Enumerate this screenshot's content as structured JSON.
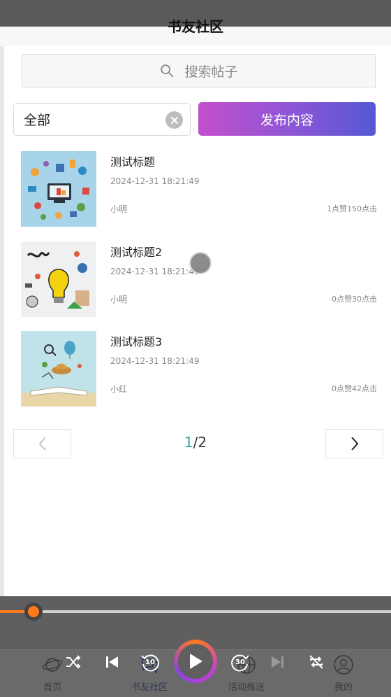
{
  "header": {
    "title": "书友社区"
  },
  "search": {
    "placeholder": "搜索帖子"
  },
  "filter": {
    "value": "全部"
  },
  "publish": {
    "label": "发布内容"
  },
  "posts": [
    {
      "title": "测试标题",
      "date": "2024-12-31 18:21:49",
      "author": "小明",
      "stats": "1点赞150点击"
    },
    {
      "title": "测试标题2",
      "date": "2024-12-31 18:21:49",
      "author": "小明",
      "stats": "0点赞30点击"
    },
    {
      "title": "测试标题3",
      "date": "2024-12-31 18:21:49",
      "author": "小红",
      "stats": "0点赞42点击"
    }
  ],
  "pagination": {
    "current": "1",
    "total": "/2"
  },
  "player": {
    "progress_fraction": 0.085,
    "rewind_seconds": "10",
    "forward_seconds": "30"
  },
  "tabbar": {
    "items": [
      {
        "label": "首页",
        "icon": "planet-icon"
      },
      {
        "label": "书友社区",
        "icon": "chat-bubbles-icon",
        "active": true
      },
      {
        "label": "活动推送",
        "icon": "globe-icon"
      },
      {
        "label": "我的",
        "icon": "user-icon"
      }
    ]
  },
  "colors": {
    "accent_orange": "#ff7a1a",
    "page_current": "#2ba59a",
    "publish_gradient_start": "#c34fcb",
    "publish_gradient_end": "#5458d3"
  }
}
